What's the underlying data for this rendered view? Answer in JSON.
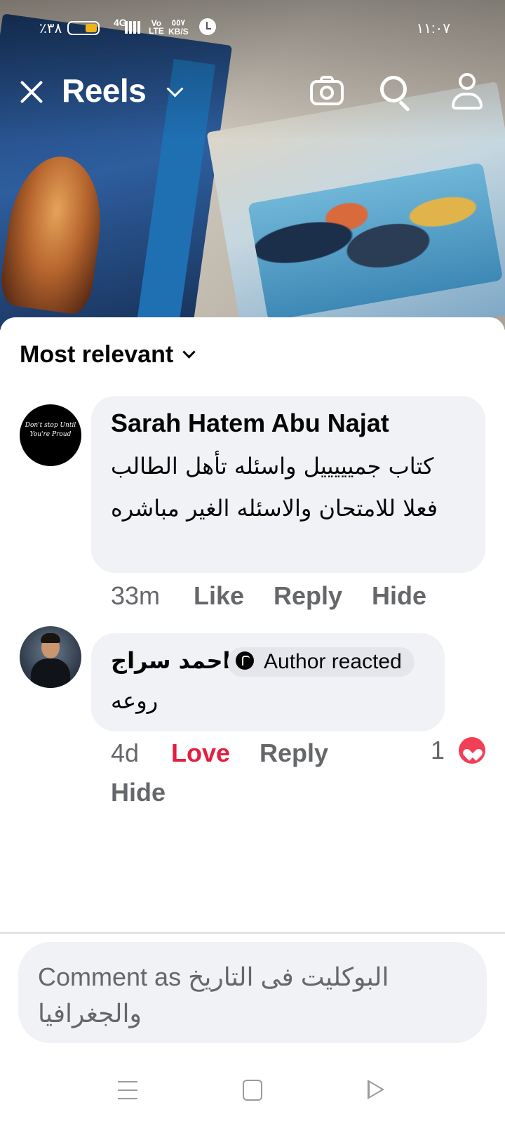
{
  "status_bar": {
    "battery_percent": "٪٣٨",
    "network": "4G",
    "volte": "Vo\nLTE",
    "speed": "٥٥٧\nKB/S",
    "time": "١١:٠٧"
  },
  "header": {
    "title": "Reels",
    "icons": [
      "close-icon",
      "chevron-down-icon",
      "camera-icon",
      "search-icon",
      "profile-icon"
    ]
  },
  "comments_sheet": {
    "sort_label": "Most relevant",
    "comments": [
      {
        "author": "Sarah Hatem Abu Najat",
        "avatar_text": "Don't stop Until You're Proud",
        "text": "كتاب جميييييل واسئله تأهل الطالب فعلا للامتحان والاسئله الغير مباشره",
        "time": "33m",
        "actions": [
          "Like",
          "Reply",
          "Hide"
        ]
      },
      {
        "author": "احمد سراج",
        "badge": "Author reacted",
        "text": "روعه",
        "time": "4d",
        "actions": [
          "Love",
          "Reply",
          "Hide"
        ],
        "reaction_count": "1",
        "reaction_icon": "heart-icon"
      }
    ],
    "composer_placeholder": "Comment as البوكليت فى التاريخ والجغرافيا"
  },
  "colors": {
    "love": "#e41e3f",
    "bubble": "#f0f2f5",
    "secondary_text": "#65676b",
    "heart": "#f33e58"
  }
}
